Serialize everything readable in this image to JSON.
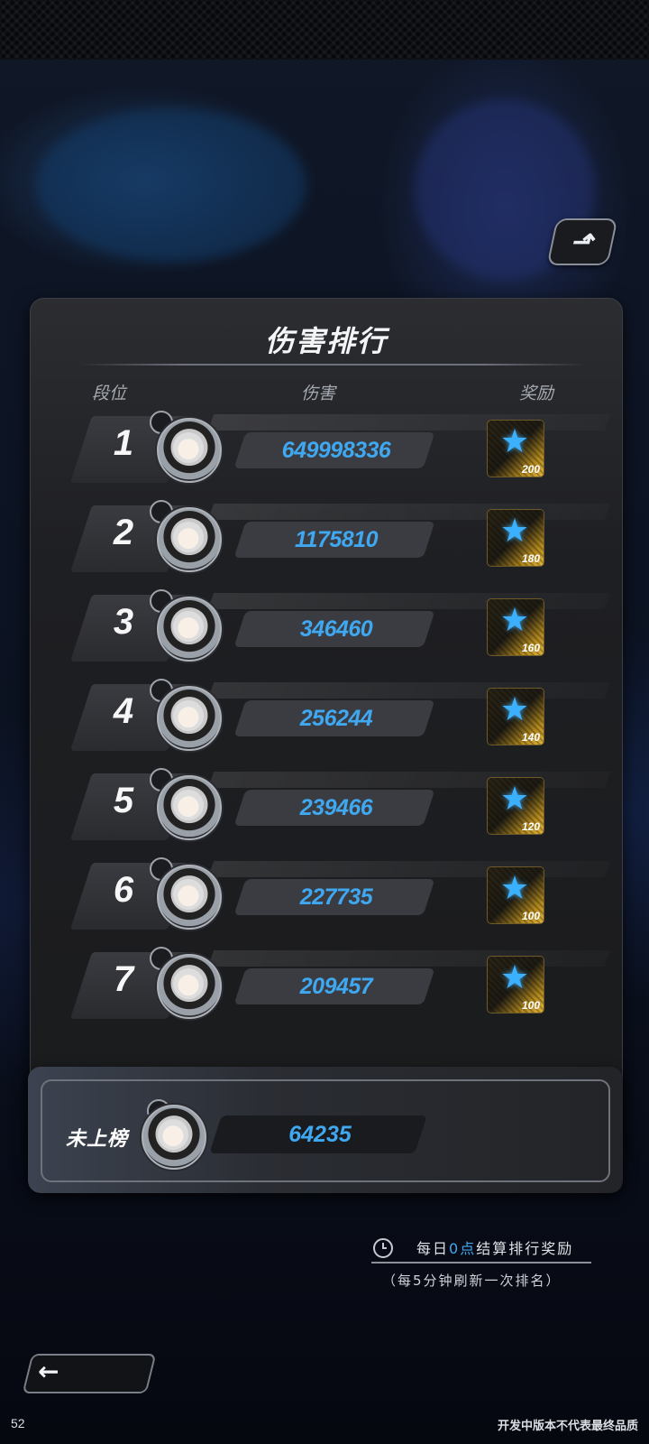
{
  "title": "伤害排行",
  "headers": {
    "rank": "段位",
    "damage": "伤害",
    "reward": "奖励"
  },
  "rows": [
    {
      "rank": "1",
      "damage": "649998336",
      "reward": "200"
    },
    {
      "rank": "2",
      "damage": "1175810",
      "reward": "180"
    },
    {
      "rank": "3",
      "damage": "346460",
      "reward": "160"
    },
    {
      "rank": "4",
      "damage": "256244",
      "reward": "140"
    },
    {
      "rank": "5",
      "damage": "239466",
      "reward": "120"
    },
    {
      "rank": "6",
      "damage": "227735",
      "reward": "100"
    },
    {
      "rank": "7",
      "damage": "209457",
      "reward": "100"
    }
  ],
  "me": {
    "label": "未上榜",
    "damage": "64235"
  },
  "info": {
    "settle_prefix": "每日",
    "settle_highlight": "0点",
    "settle_suffix": "结算排行奖励",
    "refresh": "（每5分钟刷新一次排名）"
  },
  "footer": {
    "version": "52",
    "disclaimer": "开发中版本不代表最终品质"
  },
  "icons": {
    "share": "share-icon",
    "back": "back-arrow-icon",
    "clock": "clock-icon",
    "reward": "star-icon",
    "avatar": "avatar-icon"
  },
  "colors": {
    "accent": "#3fa8f0",
    "panel": "#1e1f22",
    "reward_gold": "#e0b23a"
  }
}
